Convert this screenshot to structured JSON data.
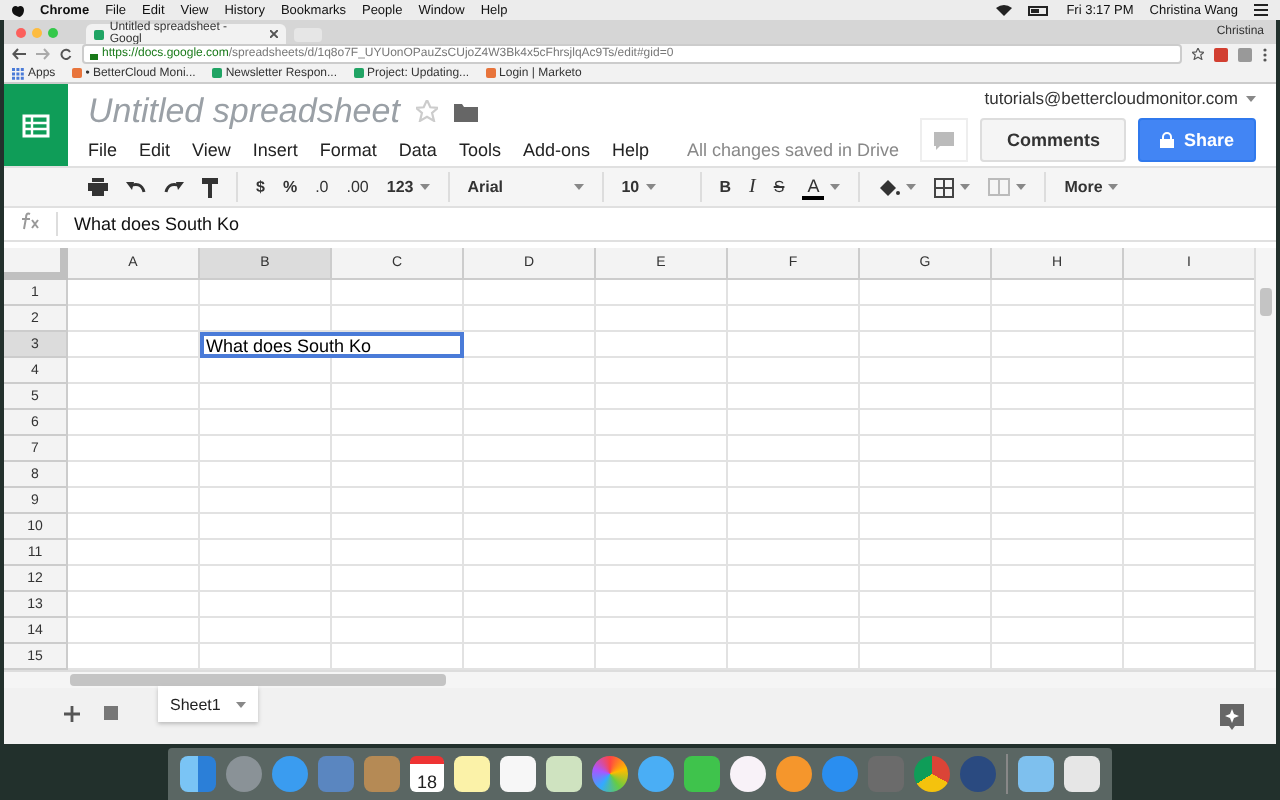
{
  "mac_menubar": {
    "items": [
      "Chrome",
      "File",
      "Edit",
      "View",
      "History",
      "Bookmarks",
      "People",
      "Window",
      "Help"
    ],
    "clock": "Fri 3:17 PM",
    "user": "Christina Wang"
  },
  "browser": {
    "tab_title": "Untitled spreadsheet - Googl",
    "profile": "Christina",
    "url_host": "https://docs.google.com",
    "url_path": "/spreadsheets/d/1q8o7F_UYUonOPauZsCUjoZ4W3Bk4x5cFhrsjlqAc9Ts/edit#gid=0",
    "bookmarks": [
      {
        "label": "Apps",
        "kind": "apps"
      },
      {
        "label": "• BetterCloud Moni...",
        "kind": "site"
      },
      {
        "label": "Newsletter Respon...",
        "kind": "sheet"
      },
      {
        "label": "Project: Updating...",
        "kind": "sheet"
      },
      {
        "label": "Login | Marketo",
        "kind": "site"
      }
    ]
  },
  "document": {
    "title": "Untitled spreadsheet",
    "starred": false,
    "menus": [
      "File",
      "Edit",
      "View",
      "Insert",
      "Format",
      "Data",
      "Tools",
      "Add-ons",
      "Help"
    ],
    "save_status": "All changes saved in Drive",
    "account": "tutorials@bettercloudmonitor.com",
    "comments_button": "Comments",
    "share_button": "Share"
  },
  "toolbar": {
    "currency": "$",
    "percent": "%",
    "decrease_decimals": ".0",
    "increase_decimals": ".00",
    "number_format": "123",
    "font": "Arial",
    "font_size": "10",
    "bold": "B",
    "italic": "I",
    "strikethrough": "S",
    "text_color": "A",
    "more": "More"
  },
  "formula_bar": {
    "value": "What does South Ko"
  },
  "grid": {
    "columns": [
      {
        "label": "A",
        "selected": false
      },
      {
        "label": "B",
        "selected": true
      },
      {
        "label": "C",
        "selected": false
      },
      {
        "label": "D",
        "selected": false
      },
      {
        "label": "E",
        "selected": false
      },
      {
        "label": "F",
        "selected": false
      },
      {
        "label": "G",
        "selected": false
      },
      {
        "label": "H",
        "selected": false
      },
      {
        "label": "I",
        "selected": false
      }
    ],
    "rows": [
      {
        "label": "1",
        "selected": false
      },
      {
        "label": "2",
        "selected": false
      },
      {
        "label": "3",
        "selected": true
      },
      {
        "label": "4",
        "selected": false
      },
      {
        "label": "5",
        "selected": false
      },
      {
        "label": "6",
        "selected": false
      },
      {
        "label": "7",
        "selected": false
      },
      {
        "label": "8",
        "selected": false
      },
      {
        "label": "9",
        "selected": false
      },
      {
        "label": "10",
        "selected": false
      },
      {
        "label": "11",
        "selected": false
      },
      {
        "label": "12",
        "selected": false
      },
      {
        "label": "13",
        "selected": false
      },
      {
        "label": "14",
        "selected": false
      },
      {
        "label": "15",
        "selected": false
      }
    ],
    "active_cell_value": "What does South Ko"
  },
  "sheets": [
    {
      "label": "Sheet1",
      "selected": true
    }
  ],
  "dock": {
    "calendar_day": "18"
  }
}
